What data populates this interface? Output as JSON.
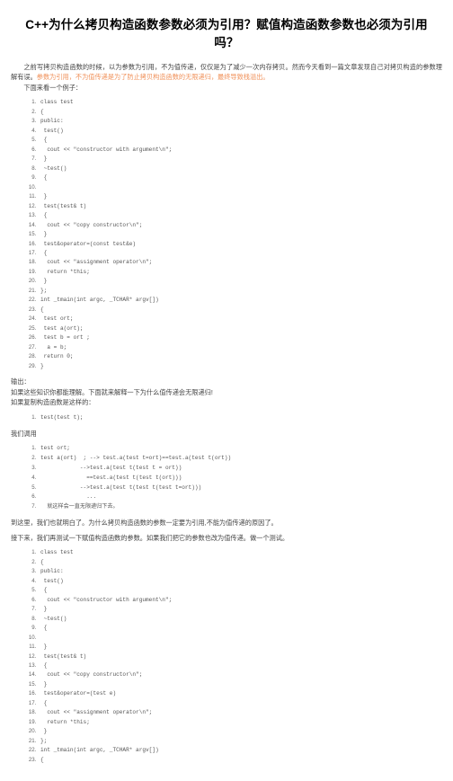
{
  "article": {
    "title": "C++为什么拷贝构造函数参数必须为引用？赋值构造函数参数也必须为引用吗？",
    "intro_part1": "之前写拷贝构造函数的时候，以为参数为引用，不为值传递，仅仅是为了减少一次内存拷贝。然而今天看到一篇文章发现自己对拷贝构造的参数理解有误。",
    "intro_highlight": "参数为引用，不为值传递是为了防止拷贝构造函数的无限递归，最终导致栈溢出。",
    "line_example_intro": "下面来看一个例子：",
    "output_label": "输出：",
    "explain_line1": "如果这些知识你都能理解。下面就来解释一下为什么值传递会无限递归!",
    "explain_line2": "如果复制构造函数是这样的：",
    "call_label": "我们调用",
    "conclusion": "到这里，我们也就明白了。为什么拷贝构造函数的参数一定要为引用,不能为值传递的原因了。",
    "next_test": "接下来，我们再测试一下赋值构造函数的参数。如果我们把它的参数也改为值传递。做一个测试。"
  },
  "code_block_1": [
    "class test",
    "{",
    "public:",
    " test()",
    " {",
    "  cout << \"constructor with argument\\n\";",
    " }",
    " ~test()",
    " {",
    "",
    " }",
    " test(test& t)",
    " {",
    "  cout << \"copy constructor\\n\";",
    " }",
    " test&operator=(const test&e)",
    " {",
    "  cout << \"assignment operator\\n\";",
    "  return *this;",
    " }",
    "};",
    "int _tmain(int argc, _TCHAR* argv[])",
    "{",
    " test ort;",
    " test a(ort);",
    " test b = ort ;",
    "  a = b;",
    " return 0;",
    "}"
  ],
  "code_block_2": [
    "test(test t);"
  ],
  "code_block_3": [
    "test ort;",
    "test a(ort)  ; --> test.a(test t=ort)==test.a(test t(ort))",
    "            -->test.a(test t(test t = ort))",
    "              ==test.a(test t(test t(ort)))",
    "            -->test.a(test t(test t(test t=ort)))",
    "              ...",
    "  就这样会一直无限递归下去。"
  ],
  "code_block_4": [
    "class test",
    "{",
    "public:",
    " test()",
    " {",
    "  cout << \"constructor with argument\\n\";",
    " }",
    " ~test()",
    " {",
    "",
    " }",
    " test(test& t)",
    " {",
    "  cout << \"copy constructor\\n\";",
    " }",
    " test&operator=(test e)",
    " {",
    "  cout << \"assignment operator\\n\";",
    "  return *this;",
    " }",
    "};",
    "int _tmain(int argc, _TCHAR* argv[])",
    "{"
  ]
}
